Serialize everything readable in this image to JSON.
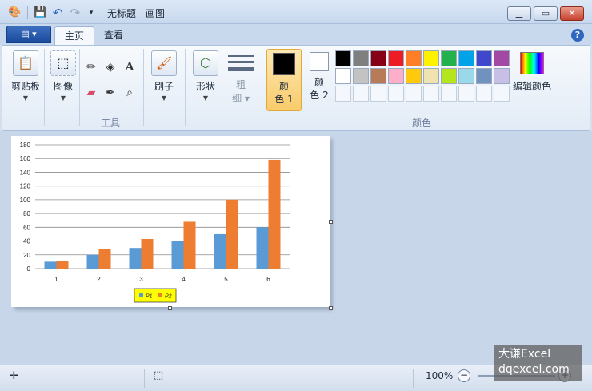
{
  "window": {
    "title": "无标题 - 画图"
  },
  "tabs": [
    {
      "label": "主页"
    },
    {
      "label": "查看"
    }
  ],
  "ribbon": {
    "clipboard": {
      "label": "剪贴板"
    },
    "image": {
      "label": "图像"
    },
    "tools": {
      "group_label": "工具"
    },
    "brushes": {
      "label": "刷子"
    },
    "shapes": {
      "label": "形状"
    },
    "size": {
      "label_line1": "粗",
      "label_line2": "细"
    },
    "color1": {
      "label_line1": "颜",
      "label_line2": "色 1",
      "color": "#000000"
    },
    "color2": {
      "label_line1": "颜",
      "label_line2": "色 2",
      "color": "#ffffff"
    },
    "colors_group_label": "颜色",
    "edit_colors": {
      "label": "编辑颜色"
    },
    "palette_row1": [
      "#000000",
      "#7f7f7f",
      "#880015",
      "#ed1c24",
      "#ff7f27",
      "#fff200",
      "#22b14c",
      "#00a2e8",
      "#3f48cc",
      "#a349a4"
    ],
    "palette_row2": [
      "#ffffff",
      "#c3c3c3",
      "#b97a57",
      "#ffaec9",
      "#ffc90e",
      "#efe4b0",
      "#b5e61d",
      "#99d9ea",
      "#7092be",
      "#c8bfe7"
    ]
  },
  "chart_data": {
    "type": "bar",
    "categories": [
      "1",
      "2",
      "3",
      "4",
      "5",
      "6"
    ],
    "series": [
      {
        "name": "P1",
        "values": [
          10,
          20,
          30,
          40,
          50,
          60
        ],
        "color": "#5b9bd5"
      },
      {
        "name": "P2",
        "values": [
          11,
          29,
          43,
          68,
          100,
          158
        ],
        "color": "#ed7d31"
      }
    ],
    "yticks": [
      "0",
      "20",
      "40",
      "60",
      "80",
      "100",
      "120",
      "140",
      "160",
      "180"
    ],
    "ylim": [
      0,
      180
    ],
    "grid": true,
    "legend_position": "bottom",
    "legend_background": "#ffff00"
  },
  "status": {
    "zoom": "100%"
  },
  "watermark": {
    "line1": "大谦Excel",
    "line2": "dqexcel.com"
  }
}
